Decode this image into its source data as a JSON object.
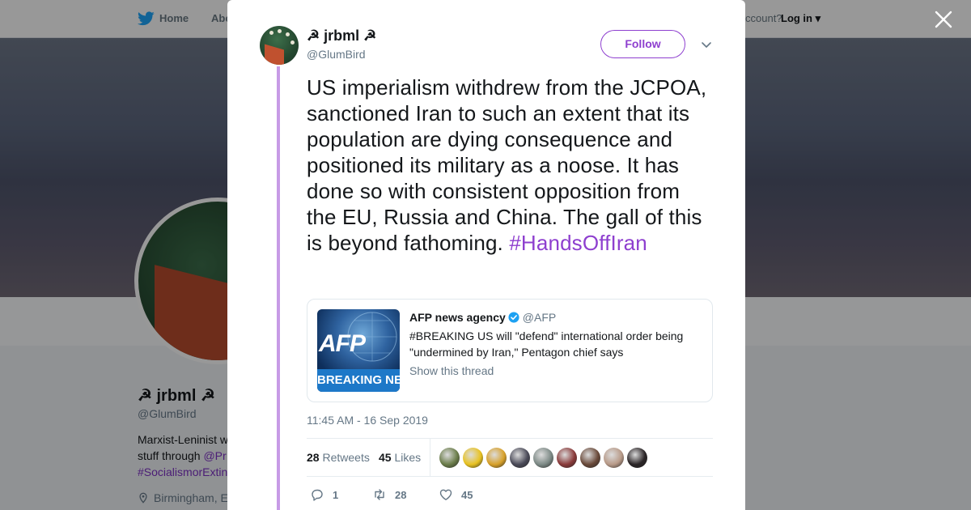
{
  "background": {
    "nav": {
      "home": "Home",
      "about": "Abo",
      "account_prompt": "ccount?",
      "login": "Log in"
    },
    "profile": {
      "name": "☭ jrbml ☭",
      "handle": "@GlumBird",
      "bio_line1": "Marxist-Leninist w",
      "bio_line2_text": "stuff through ",
      "bio_line2_link": "@Pr",
      "bio_line3": "#SocialismorExtin",
      "location": "Birmingham, E"
    }
  },
  "tweet": {
    "author": {
      "name": "☭ jrbml ☭",
      "handle": "@GlumBird"
    },
    "follow_label": "Follow",
    "text": "US imperialism withdrew from the JCPOA, sanctioned Iran to such an extent that its population are dying consequence and positioned its military as a noose. It has done so with consistent opposition from the EU, Russia and China. The gall of this is beyond fathoming. ",
    "hashtag": "#HandsOffIran",
    "quote": {
      "name": "AFP news agency",
      "handle": "@AFP",
      "text": "#BREAKING US will \"defend\" international order being \"undermined by Iran,\" Pentagon chief says",
      "thread_link": "Show this thread",
      "image_logo": "AFP",
      "image_banner": "BREAKING NEWS"
    },
    "timestamp": "11:45 AM - 16 Sep 2019",
    "stats": {
      "retweets_count": "28",
      "retweets_label": "Retweets",
      "likes_count": "45",
      "likes_label": "Likes"
    },
    "likers": [
      {
        "color": "#6b7d4a"
      },
      {
        "color": "#e8c220"
      },
      {
        "color": "#d8a12a"
      },
      {
        "color": "#4a4a58"
      },
      {
        "color": "#7d8a86"
      },
      {
        "color": "#8a3a3a"
      },
      {
        "color": "#6a4a3a"
      },
      {
        "color": "#b89a88"
      },
      {
        "color": "#2a2426"
      }
    ],
    "actions": {
      "reply_count": "1",
      "retweet_count": "28",
      "like_count": "45"
    }
  },
  "colors": {
    "accent": "#8e3fcf",
    "thread_line": "#c79be6",
    "verified": "#1da1f2"
  }
}
